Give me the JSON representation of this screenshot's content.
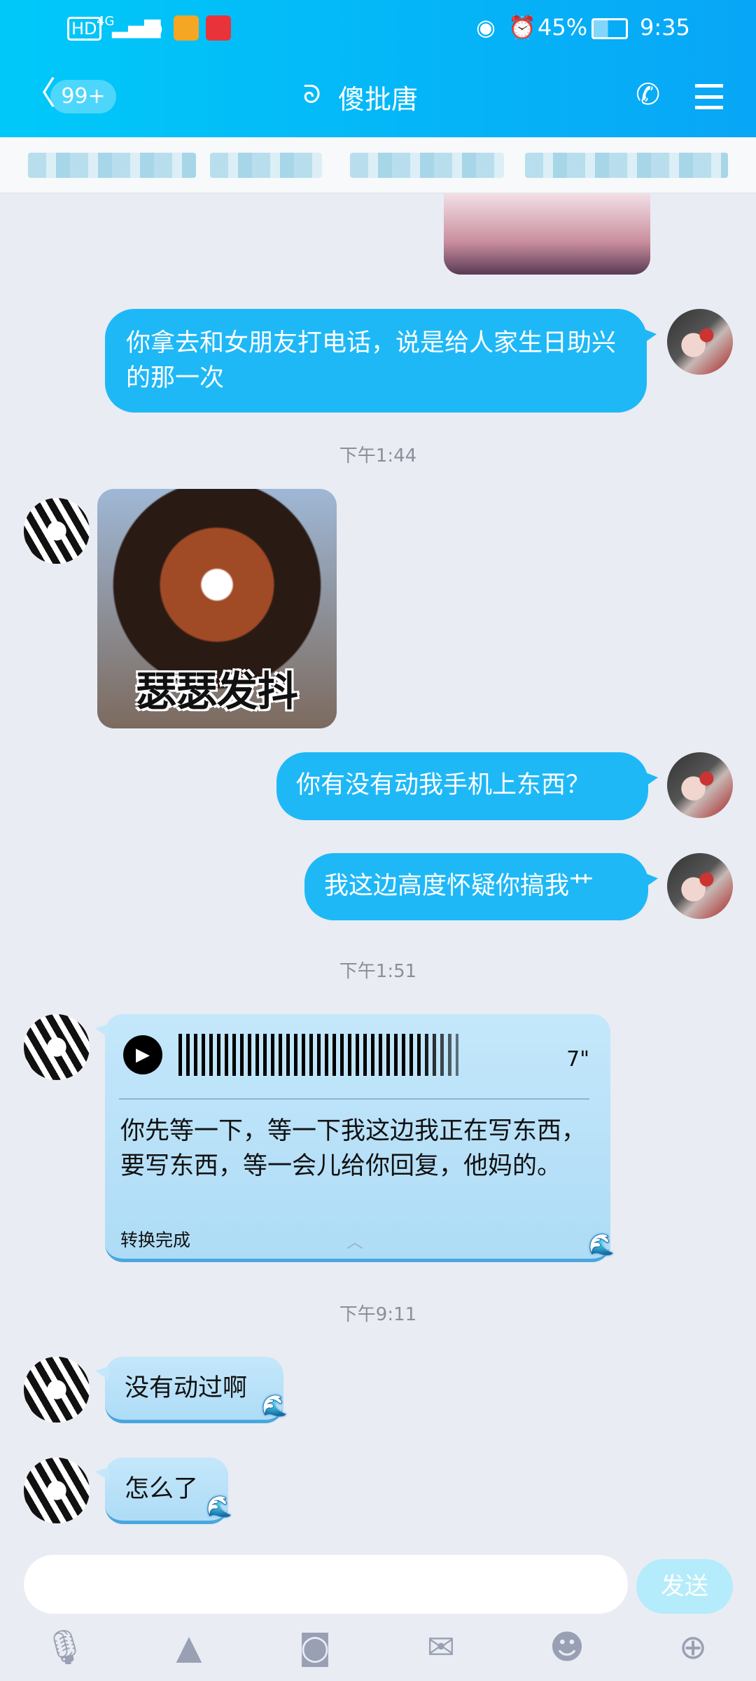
{
  "status_bar": {
    "network": "4G",
    "battery": "45%",
    "time": "9:35",
    "hd": "HD"
  },
  "header": {
    "back_badge": "99+",
    "title": "傻批唐"
  },
  "timestamps": [
    "下午1:44",
    "下午1:51",
    "下午9:11"
  ],
  "messages": {
    "m1": "你拿去和女朋友打电话，说是给人家生日助兴的那一次",
    "sticker_caption": "瑟瑟发抖",
    "m2": "你有没有动我手机上东西？",
    "m3": "我这边高度怀疑你搞我艹",
    "voice": {
      "duration": "7\"",
      "transcript": "你先等一下，等一下我这边我正在写东西，要写东西，等一会儿给你回复，他妈的。",
      "status": "转换完成"
    },
    "m4": "没有动过啊",
    "m5": "怎么了"
  },
  "input": {
    "value": "",
    "send_label": "发送"
  },
  "colors": {
    "accent": "#1fb8f7",
    "header": "#00c9f9",
    "background": "#e9ecf3"
  }
}
